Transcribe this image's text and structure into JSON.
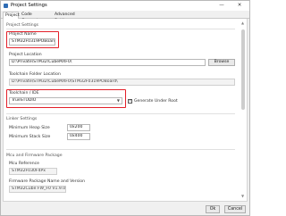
{
  "window": {
    "title": "Project Settings",
    "minimize_glyph": "—",
    "close_glyph": "✕"
  },
  "tabs": [
    {
      "label": "Project",
      "active": true
    },
    {
      "label": "Code Generator",
      "active": false
    },
    {
      "label": "Advanced Settings",
      "active": false
    }
  ],
  "project_settings": {
    "section_label": "Project Settings",
    "project_name": {
      "label": "Project Name",
      "value": "STM32F0319POBoard"
    },
    "project_location": {
      "label": "Project Location",
      "value": "D:\\Private\\STM32\\CubeMXF0\\",
      "browse_label": "Browse"
    },
    "toolchain_folder": {
      "label": "Toolchain Folder Location",
      "value": "D:\\Private\\STM32\\CubeMXF0\\STM32F0319POBoard\\"
    },
    "toolchain_ide": {
      "label": "Toolchain / IDE",
      "value": "TrueSTUDIO"
    },
    "generate_under_root": {
      "label": "Generate Under Root",
      "checked": true
    }
  },
  "linker_settings": {
    "section_label": "Linker Settings",
    "min_heap": {
      "label": "Minimum Heap Size",
      "value": "0x200"
    },
    "min_stack": {
      "label": "Minimum Stack Size",
      "value": "0x400"
    }
  },
  "mcu_package": {
    "section_label": "Mcu and Firmware Package",
    "mcu_reference": {
      "label": "Mcu Reference",
      "value": "STM32F030F4Px"
    },
    "firmware_package": {
      "label": "Firmware Package Name and Version",
      "value": "STM32Cube FW_F0 V1.9.0"
    }
  },
  "footer": {
    "ok_label": "Ok",
    "cancel_label": "Cancel"
  },
  "colors": {
    "highlight": "#e3202a"
  }
}
